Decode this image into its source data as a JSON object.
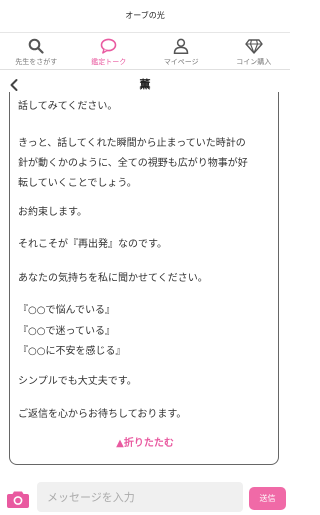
{
  "app": {
    "title": "オーブの光"
  },
  "tabs": [
    {
      "label": "先生をさがす",
      "icon": "search-icon",
      "active": false
    },
    {
      "label": "鑑定トーク",
      "icon": "chat-bubble-icon",
      "active": true
    },
    {
      "label": "マイページ",
      "icon": "user-icon",
      "active": false
    },
    {
      "label": "コイン購入",
      "icon": "diamond-icon",
      "active": false
    }
  ],
  "header": {
    "title": "薫",
    "back_icon": "chevron-left-icon"
  },
  "message": {
    "lines": [
      "話してみてください。",
      "",
      "きっと、話してくれた瞬間から止まっていた時計の",
      "針が動くかのように、全ての視野も広がり物事が好",
      "転していくことでしょう。",
      "",
      "お約束します。",
      "",
      "それこそが『再出発』なのです。",
      "",
      "あなたの気持ちを私に聞かせてください。",
      "",
      "『○○で悩んでいる』",
      "『○○で迷っている』",
      "『○○に不安を感じる』",
      "",
      "シンプルでも大丈夫です。",
      "",
      "ご返信を心からお待ちしております。"
    ],
    "fold_label": "▲折りたたむ"
  },
  "composer": {
    "placeholder": "メッセージを入力",
    "value": "",
    "send_label": "送信",
    "camera_icon": "camera-icon"
  },
  "colors": {
    "accent": "#e95aa0",
    "send_button": "#f06aa7",
    "camera": "#e95aa0",
    "input_bg": "#f0f0f0"
  }
}
